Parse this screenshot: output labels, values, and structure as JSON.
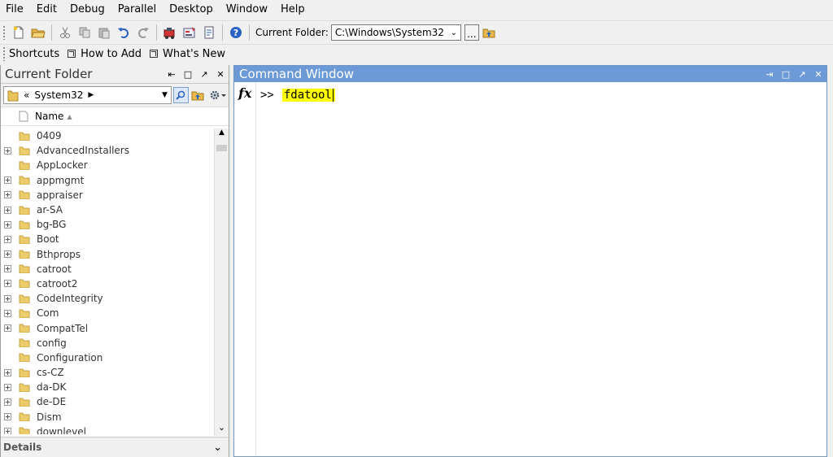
{
  "menu": [
    "File",
    "Edit",
    "Debug",
    "Parallel",
    "Desktop",
    "Window",
    "Help"
  ],
  "toolbar": {
    "buttons": [
      "new-file",
      "open-file",
      "cut",
      "copy",
      "paste",
      "undo",
      "redo",
      "simulink",
      "guide",
      "profiler",
      "help"
    ],
    "current_folder_label": "Current Folder:",
    "current_folder_value": "C:\\Windows\\System32",
    "browse_label": "..."
  },
  "shortcuts": {
    "label": "Shortcuts",
    "how_to_add": "How to Add",
    "whats_new": "What's New"
  },
  "current_folder_panel": {
    "title": "Current Folder",
    "address_prefix": "«",
    "address_crumb": "System32",
    "column_name": "Name",
    "items": [
      {
        "name": "0409",
        "expandable": false
      },
      {
        "name": "AdvancedInstallers",
        "expandable": true
      },
      {
        "name": "AppLocker",
        "expandable": false
      },
      {
        "name": "appmgmt",
        "expandable": true
      },
      {
        "name": "appraiser",
        "expandable": true
      },
      {
        "name": "ar-SA",
        "expandable": true
      },
      {
        "name": "bg-BG",
        "expandable": true
      },
      {
        "name": "Boot",
        "expandable": true
      },
      {
        "name": "Bthprops",
        "expandable": true
      },
      {
        "name": "catroot",
        "expandable": true
      },
      {
        "name": "catroot2",
        "expandable": true
      },
      {
        "name": "CodeIntegrity",
        "expandable": true
      },
      {
        "name": "Com",
        "expandable": true
      },
      {
        "name": "CompatTel",
        "expandable": true
      },
      {
        "name": "config",
        "expandable": false
      },
      {
        "name": "Configuration",
        "expandable": false
      },
      {
        "name": "cs-CZ",
        "expandable": true
      },
      {
        "name": "da-DK",
        "expandable": true
      },
      {
        "name": "de-DE",
        "expandable": true
      },
      {
        "name": "Dism",
        "expandable": true
      },
      {
        "name": "downlevel",
        "expandable": true
      }
    ],
    "details_label": "Details"
  },
  "command_window": {
    "title": "Command Window",
    "fx_label": "fx",
    "prompt": ">>",
    "command": "fdatool"
  },
  "colors": {
    "cmd_title_bg": "#6b9ad6",
    "highlight": "#ffff00"
  }
}
